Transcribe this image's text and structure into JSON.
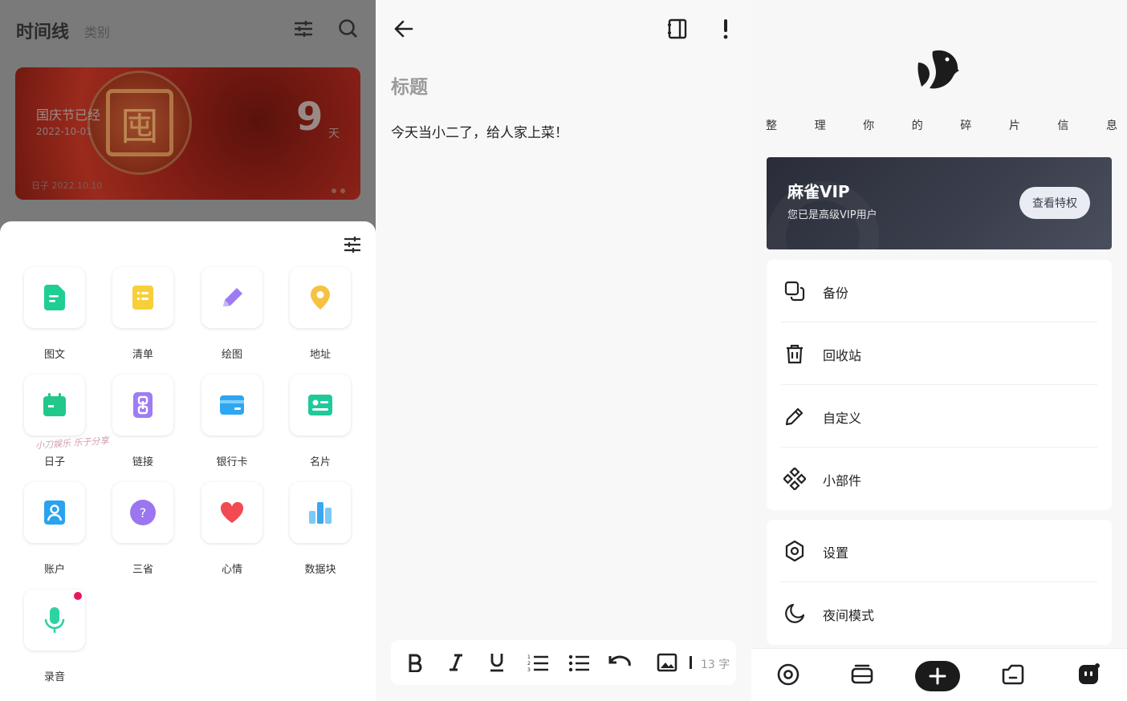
{
  "left": {
    "app_title": "时间线",
    "category_tab": "类别",
    "card": {
      "title": "国庆节已经",
      "date": "2022-10-01",
      "count": "9",
      "unit": "天",
      "footer": "日子 2022.10.10"
    },
    "grid": [
      {
        "label": "图文",
        "icon": "doc-icon",
        "color": "#1fce93"
      },
      {
        "label": "清单",
        "icon": "checklist-icon",
        "color": "#f7cf3b"
      },
      {
        "label": "绘图",
        "icon": "pencil-icon",
        "color": "#9b7cf2"
      },
      {
        "label": "地址",
        "icon": "location-icon",
        "color": "#f5c242"
      },
      {
        "label": "日子",
        "icon": "calendar-icon",
        "color": "#21c88a"
      },
      {
        "label": "链接",
        "icon": "link-icon",
        "color": "#9d7cf4"
      },
      {
        "label": "银行卡",
        "icon": "bank-card-icon",
        "color": "#2ea6f2"
      },
      {
        "label": "名片",
        "icon": "business-card-icon",
        "color": "#20c99a"
      },
      {
        "label": "账户",
        "icon": "account-icon",
        "color": "#2aa2f0"
      },
      {
        "label": "三省",
        "icon": "question-icon",
        "color": "#9b76f1"
      },
      {
        "label": "心情",
        "icon": "heart-icon",
        "color": "#f24a52"
      },
      {
        "label": "数据块",
        "icon": "data-block-icon",
        "color": "#3aa7f0"
      },
      {
        "label": "录音",
        "icon": "microphone-icon",
        "color": "#2fd3a3"
      }
    ],
    "watermark": "小刀娱乐 乐于分享"
  },
  "editor": {
    "title_placeholder": "标题",
    "body": "今天当小二了，给人家上菜！",
    "word_count": "13 字"
  },
  "right": {
    "slogan": [
      "整",
      "理",
      "你",
      "的",
      "碎",
      "片",
      "信",
      "息"
    ],
    "vip": {
      "title": "麻雀VIP",
      "subtitle": "您已是高级VIP用户",
      "button": "查看特权"
    },
    "menu_group1": [
      {
        "label": "备份",
        "icon": "backup-icon"
      },
      {
        "label": "回收站",
        "icon": "trash-icon"
      },
      {
        "label": "自定义",
        "icon": "edit-icon"
      },
      {
        "label": "小部件",
        "icon": "widgets-icon"
      }
    ],
    "menu_group2": [
      {
        "label": "设置",
        "icon": "settings-icon"
      },
      {
        "label": "夜间模式",
        "icon": "moon-icon"
      }
    ]
  }
}
